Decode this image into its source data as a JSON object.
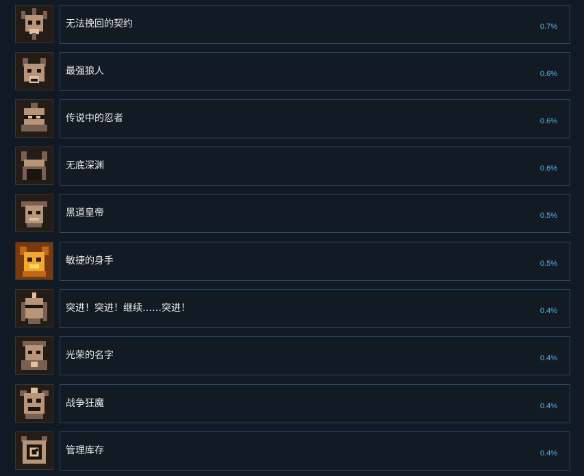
{
  "achievements": [
    {
      "title": "无法挽回的契约",
      "percent": "0.7%",
      "icon": "horned-skull-sword-icon",
      "gold": false
    },
    {
      "title": "最强狼人",
      "percent": "0.6%",
      "icon": "werewolf-head-icon",
      "gold": false
    },
    {
      "title": "传说中的忍者",
      "percent": "0.6%",
      "icon": "ninja-mask-icon",
      "gold": false
    },
    {
      "title": "无底深渊",
      "percent": "0.6%",
      "icon": "abyss-pit-icon",
      "gold": false
    },
    {
      "title": "黑道皇帝",
      "percent": "0.5%",
      "icon": "gangster-boss-icon",
      "gold": false
    },
    {
      "title": "敏捷的身手",
      "percent": "0.5%",
      "icon": "agile-fighter-icon",
      "gold": true
    },
    {
      "title": "突进！突进！继续……突进！",
      "percent": "0.4%",
      "icon": "charging-knight-icon",
      "gold": false
    },
    {
      "title": "光荣的名字",
      "percent": "0.4%",
      "icon": "glorious-warrior-icon",
      "gold": false
    },
    {
      "title": "战争狂魔",
      "percent": "0.4%",
      "icon": "war-demon-icon",
      "gold": false
    },
    {
      "title": "管理库存",
      "percent": "0.4%",
      "icon": "inventory-box-icon",
      "gold": false
    }
  ],
  "colors": {
    "background": "#111a24",
    "panel_border": "#2a4a66",
    "title_text": "#e8e8e8",
    "percent_text": "#58b6ef"
  }
}
